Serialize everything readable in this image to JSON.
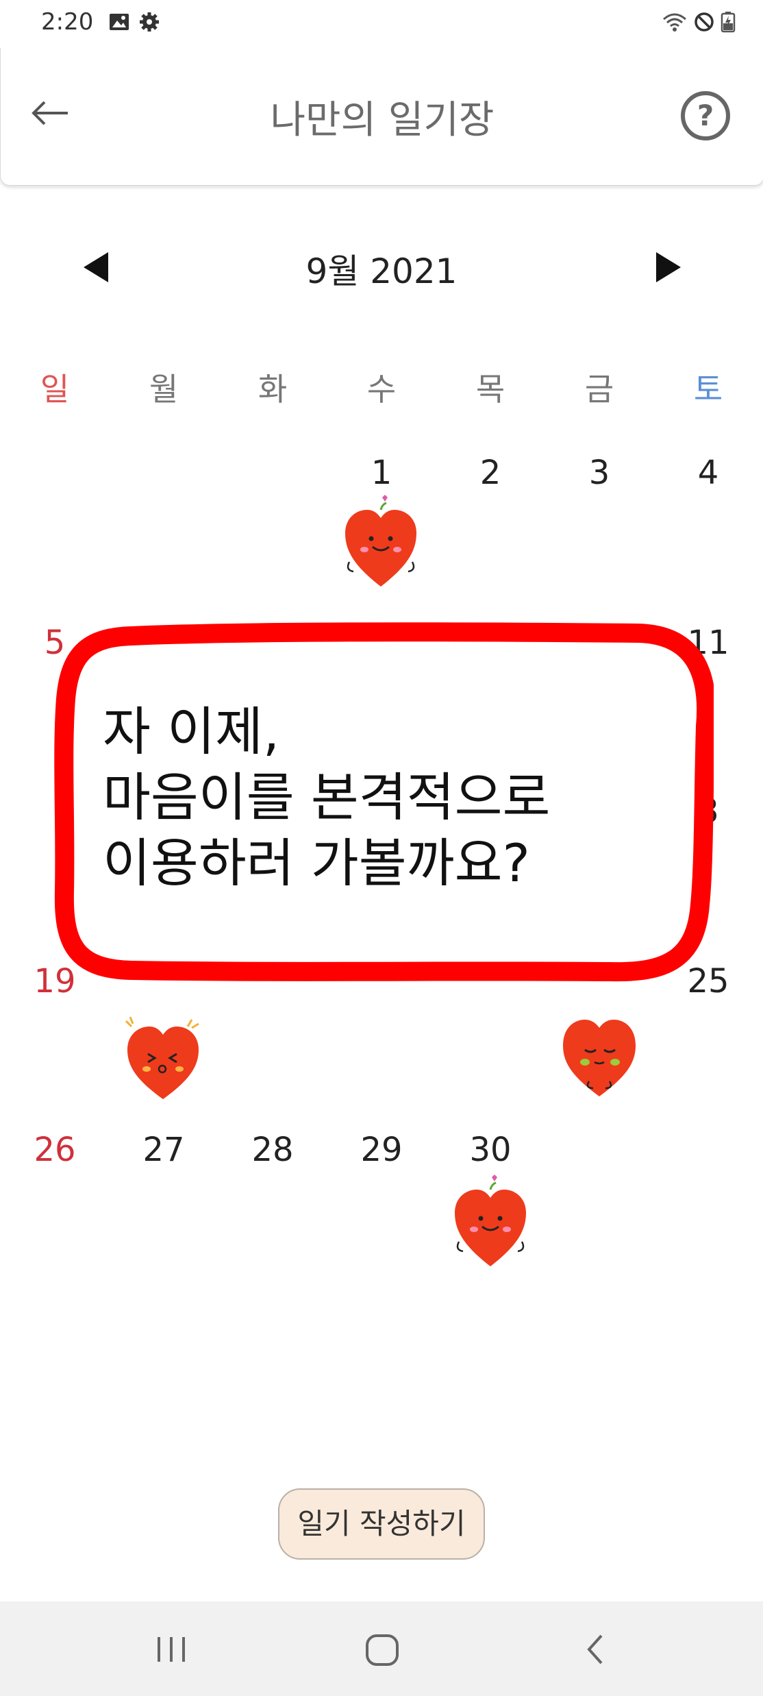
{
  "status_bar": {
    "time": "2:20"
  },
  "app_bar": {
    "title": "나만의 일기장",
    "back_label": "←",
    "help_label": "?"
  },
  "calendar": {
    "month_label": "9월 2021",
    "weekdays": [
      "일",
      "월",
      "화",
      "수",
      "목",
      "금",
      "토"
    ],
    "visible_days": [
      "1",
      "2",
      "3",
      "4",
      "5",
      "11",
      "8",
      "19",
      "25",
      "26",
      "27",
      "28",
      "29",
      "30"
    ]
  },
  "dialog": {
    "text": "자 이제,\n마음이를 본격적으로\n이용하러 가볼까요?"
  },
  "write_button": {
    "label": "일기 작성하기"
  },
  "colors": {
    "sunday": "#d0303a",
    "saturday": "#5b8fd6",
    "dialog_border": "#ff0000",
    "heart": "#ee3b1c"
  }
}
